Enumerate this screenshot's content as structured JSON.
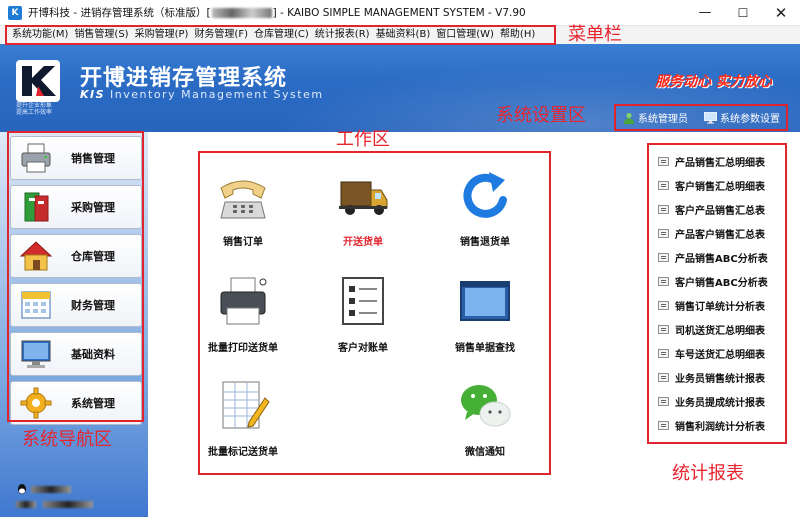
{
  "window": {
    "title_prefix": "开博科技 - 进销存管理系统（标准版）[",
    "title_suffix": "] - KAIBO SIMPLE MANAGEMENT SYSTEM - V7.90",
    "minimize_glyph": "—",
    "maximize_glyph": "☐",
    "close_glyph": "✕"
  },
  "menu": {
    "items": [
      "系统功能(M)",
      "销售管理(S)",
      "采购管理(P)",
      "财务管理(F)",
      "仓库管理(C)",
      "统计报表(R)",
      "基础资料(B)",
      "窗口管理(W)",
      "帮助(H)"
    ]
  },
  "annotations": {
    "menu_bar": "菜单栏",
    "system_settings": "系统设置区",
    "workspace": "工作区",
    "navigation": "系统导航区",
    "reports": "统计报表"
  },
  "banner": {
    "slogan_line1": "提升企业形象",
    "slogan_line2": "提高工作效率",
    "title_cn": "开博进销存管理系统",
    "title_en_prefix": "KIS",
    "title_en_rest": " Inventory Management System",
    "tagline": "服务动心  实力放心"
  },
  "system_settings": {
    "admin_label": "系统管理员",
    "params_label": "系统参数设置"
  },
  "nav": {
    "items": [
      {
        "label": "销售管理",
        "icon": "printer-icon"
      },
      {
        "label": "采购管理",
        "icon": "binders-icon"
      },
      {
        "label": "仓库管理",
        "icon": "house-icon"
      },
      {
        "label": "财务管理",
        "icon": "calendar-icon"
      },
      {
        "label": "基础资料",
        "icon": "monitor-icon"
      },
      {
        "label": "系统管理",
        "icon": "gear-icon"
      }
    ]
  },
  "workspace": {
    "items": [
      {
        "label": "销售订单",
        "icon": "telephone-icon",
        "highlight": false
      },
      {
        "label": "开送货单",
        "icon": "truck-icon",
        "highlight": true
      },
      {
        "label": "销售退货单",
        "icon": "refresh-arrow-icon",
        "highlight": false
      },
      {
        "label": "批量打印送货单",
        "icon": "printer-icon",
        "highlight": false
      },
      {
        "label": "客户对账单",
        "icon": "checklist-icon",
        "highlight": false
      },
      {
        "label": "销售单据查找",
        "icon": "window-icon",
        "highlight": false
      },
      {
        "label": "批量标记送货单",
        "icon": "spreadsheet-pen-icon",
        "highlight": false
      },
      {
        "label": "微信通知",
        "icon": "wechat-icon",
        "highlight": false
      }
    ]
  },
  "reports": {
    "items": [
      "产品销售汇总明细表",
      "客户销售汇总明细表",
      "客户产品销售汇总表",
      "产品客户销售汇总表",
      "产品销售ABC分析表",
      "客户销售ABC分析表",
      "销售订单统计分析表",
      "司机送货汇总明细表",
      "车号送货汇总明细表",
      "业务员销售统计报表",
      "业务员提成统计报表",
      "销售利润统计分析表"
    ]
  },
  "colors": {
    "annotation_red": "#e0242e",
    "banner_blue": "#2a6bc4",
    "tagline_red": "#ff2a1a"
  }
}
